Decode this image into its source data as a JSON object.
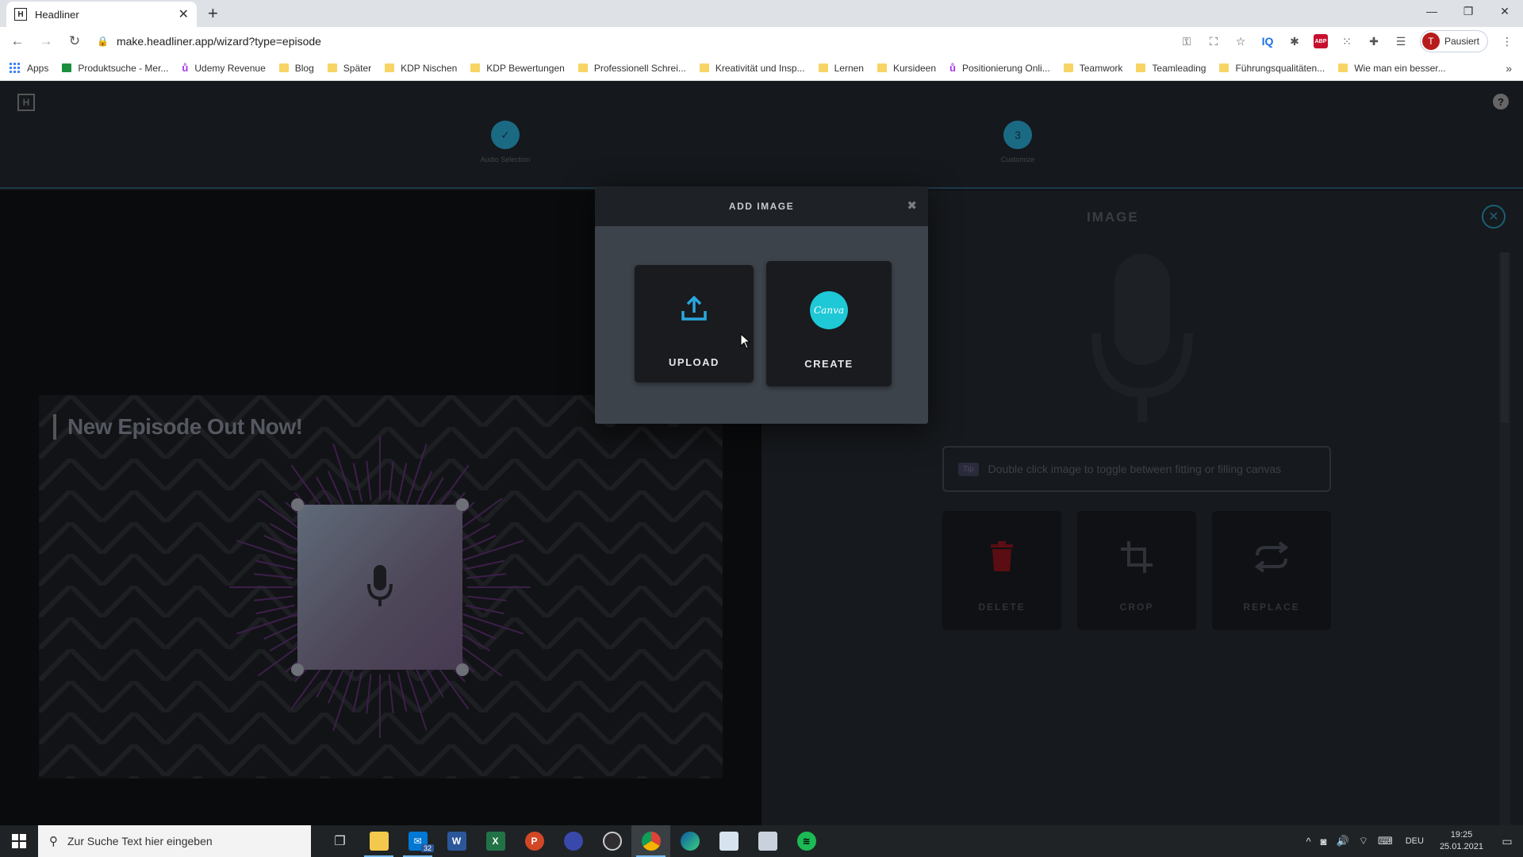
{
  "browser": {
    "tab_title": "Headliner",
    "tab_favicon": "H",
    "url": "make.headliner.app/wizard?type=episode",
    "profile_initial": "T",
    "profile_label": "Pausiert",
    "extension_abp": "ABP",
    "extension_iq": "IQ"
  },
  "bookmarks": [
    {
      "label": "Apps",
      "icon": "apps-grid"
    },
    {
      "label": "Produktsuche - Mer...",
      "icon": "green-square"
    },
    {
      "label": "Udemy Revenue",
      "icon": "udemy"
    },
    {
      "label": "Blog",
      "icon": "folder"
    },
    {
      "label": "Später",
      "icon": "folder"
    },
    {
      "label": "KDP Nischen",
      "icon": "folder"
    },
    {
      "label": "KDP Bewertungen",
      "icon": "folder"
    },
    {
      "label": "Professionell Schrei...",
      "icon": "folder"
    },
    {
      "label": "Kreativität und Insp...",
      "icon": "folder"
    },
    {
      "label": "Lernen",
      "icon": "folder"
    },
    {
      "label": "Kursideen",
      "icon": "folder"
    },
    {
      "label": "Positionierung Onli...",
      "icon": "udemy"
    },
    {
      "label": "Teamwork",
      "icon": "folder"
    },
    {
      "label": "Teamleading",
      "icon": "folder"
    },
    {
      "label": "Führungsqualitäten...",
      "icon": "folder"
    },
    {
      "label": "Wie man ein besser...",
      "icon": "folder"
    }
  ],
  "app": {
    "logo": "H",
    "steps": [
      {
        "index": "✓",
        "label": "Audio Selection"
      },
      {
        "index": "3",
        "label": "Customize"
      }
    ],
    "canvas_title": "New Episode Out Now!",
    "panel": {
      "title": "IMAGE",
      "tip_badge": "Tip",
      "tip_text": "Double click image to toggle between fitting or filling canvas",
      "actions": [
        {
          "label": "DELETE",
          "icon": "trash-icon"
        },
        {
          "label": "CROP",
          "icon": "crop-icon"
        },
        {
          "label": "REPLACE",
          "icon": "replace-icon"
        }
      ]
    }
  },
  "modal": {
    "title": "ADD IMAGE",
    "options": [
      {
        "label": "UPLOAD",
        "icon": "upload-icon"
      },
      {
        "label": "CREATE",
        "icon": "canva-logo",
        "logo_text": "Canva"
      }
    ]
  },
  "taskbar": {
    "search_placeholder": "Zur Suche Text hier eingeben",
    "mail_badge": "32",
    "language": "DEU",
    "time": "19:25",
    "date": "25.01.2021"
  },
  "colors": {
    "accent_upload": "#2aa7df",
    "canva_teal": "#1ec8d6",
    "delete_red": "#6b0f14",
    "step_blue": "#1b6a84"
  }
}
